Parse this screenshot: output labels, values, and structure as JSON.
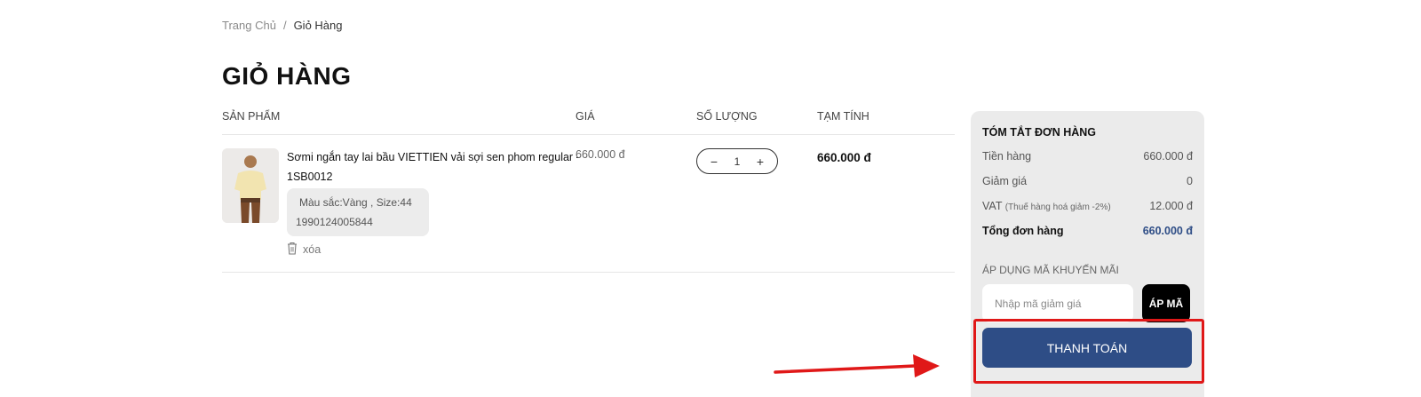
{
  "breadcrumb": {
    "home": "Trang Chủ",
    "separator": "/",
    "current": "Giỏ Hàng"
  },
  "page": {
    "title": "GIỎ HÀNG"
  },
  "cart": {
    "headers": {
      "product": "SẢN PHẨM",
      "price": "GIÁ",
      "quantity": "SỐ LƯỢNG",
      "subtotal": "TẠM TÍNH"
    },
    "items": [
      {
        "name": "Sơmi ngắn tay lai bầu VIETTIEN vải sợi sen phom regular - 1SB0012",
        "variant": "Màu sắc:Vàng , Size:44",
        "sku": "1990124005844",
        "remove_label": "xóa",
        "price": "660.000 đ",
        "quantity": "1",
        "subtotal": "660.000 đ"
      }
    ]
  },
  "summary": {
    "title": "TÓM TẮT ĐƠN HÀNG",
    "rows": {
      "goods": {
        "label": "Tiền hàng",
        "value": "660.000 đ"
      },
      "discount": {
        "label": "Giảm giá",
        "value": "0"
      },
      "vat": {
        "label": "VAT",
        "note": "(Thuế hàng hoá giảm -2%)",
        "value": "12.000 đ"
      },
      "total": {
        "label": "Tổng đơn hàng",
        "value": "660.000 đ"
      }
    },
    "promo_label": "ÁP DỤNG MÃ KHUYẾN MÃI",
    "promo_placeholder": "Nhập mã giảm giá",
    "apply_label": "ÁP MÃ",
    "checkout_label": "THANH TOÁN"
  },
  "colors": {
    "accent": "#2e4d86",
    "annotation": "#e01818"
  },
  "icons": {
    "remove": "trash-icon",
    "minus": "minus-icon",
    "plus": "plus-icon"
  }
}
